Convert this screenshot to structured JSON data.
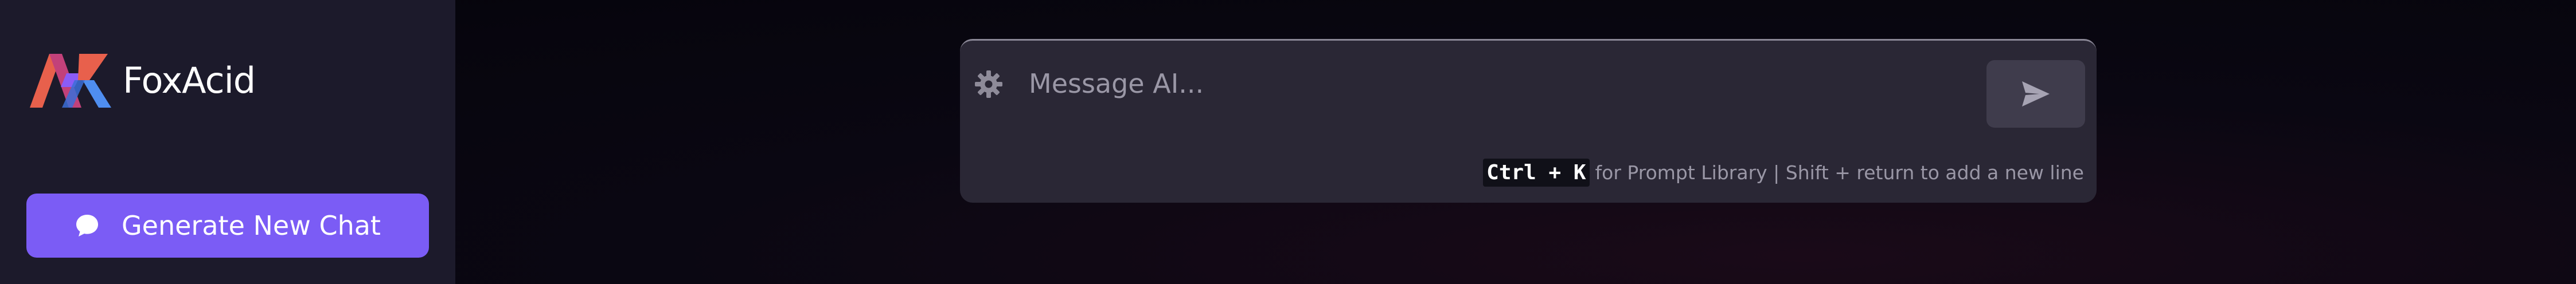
{
  "brand": {
    "name": "FoxAcid",
    "logo_icon": "foxacid-logo-icon",
    "logo_colors": [
      "#e8604c",
      "#4f8ef0",
      "#8b5cf6"
    ]
  },
  "sidebar": {
    "background": "#1c1a2b",
    "new_chat_button": {
      "label": "Generate New Chat",
      "icon": "chat-bubble-icon",
      "color": "#7b5cf5"
    }
  },
  "composer": {
    "settings_icon": "gear-icon",
    "input": {
      "placeholder": "Message AI...",
      "value": ""
    },
    "send_icon": "send-icon",
    "shortcut": {
      "keys": "Ctrl + K",
      "text": "for Prompt Library | Shift + return to add a new line"
    }
  }
}
